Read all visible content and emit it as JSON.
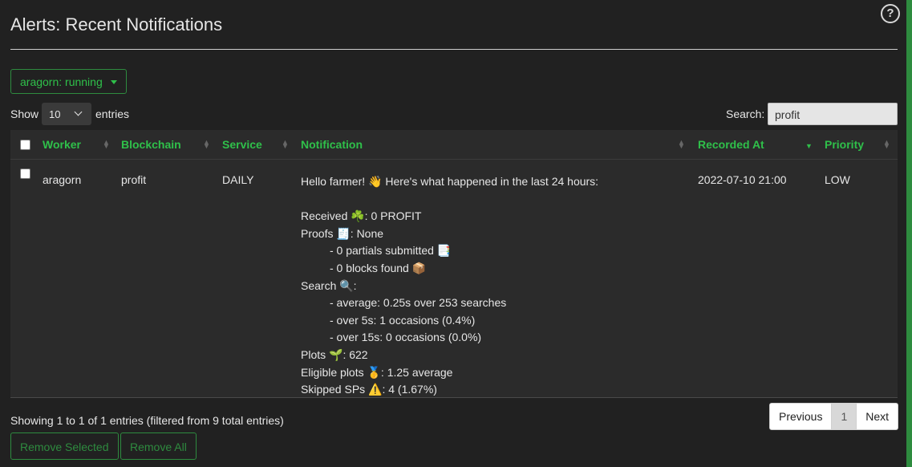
{
  "page": {
    "title": "Alerts: Recent Notifications",
    "help_glyph": "?"
  },
  "worker_dropdown": {
    "label": "aragorn: running"
  },
  "length": {
    "show_label": "Show",
    "value": "10",
    "entries_label": "entries"
  },
  "search": {
    "label": "Search:",
    "value": "profit"
  },
  "columns": [
    "Worker",
    "Blockchain",
    "Service",
    "Notification",
    "Recorded At",
    "Priority"
  ],
  "row": {
    "worker": "aragorn",
    "blockchain": "profit",
    "service": "DAILY",
    "recorded_at": "2022-07-10 21:00",
    "priority": "LOW",
    "notification": {
      "line1": "Hello farmer! 👋 Here's what happened in the last 24 hours:",
      "received": "Received ☘️: 0 PROFIT",
      "proofs": "Proofs 🧾: None",
      "partials": "- 0 partials submitted 📑",
      "blocks": "- 0 blocks found 📦",
      "search": "Search 🔍:",
      "average": "- average: 0.25s over 253 searches",
      "over5": "- over 5s: 1 occasions (0.4%)",
      "over15": "- over 15s: 0 occasions (0.0%)",
      "plots": "Plots 🌱: 622",
      "eligible": "Eligible plots 🥇: 1.25 average",
      "skipped": "Skipped SPs ⚠️: 4 (1.67%)"
    }
  },
  "footer": {
    "info": "Showing 1 to 1 of 1 entries (filtered from 9 total entries)",
    "prev": "Previous",
    "page": "1",
    "next": "Next",
    "remove_selected": "Remove Selected",
    "remove_all": "Remove All"
  },
  "colors": {
    "accent": "#2fc04a",
    "background": "#212121",
    "panel": "#2b2b2b"
  }
}
